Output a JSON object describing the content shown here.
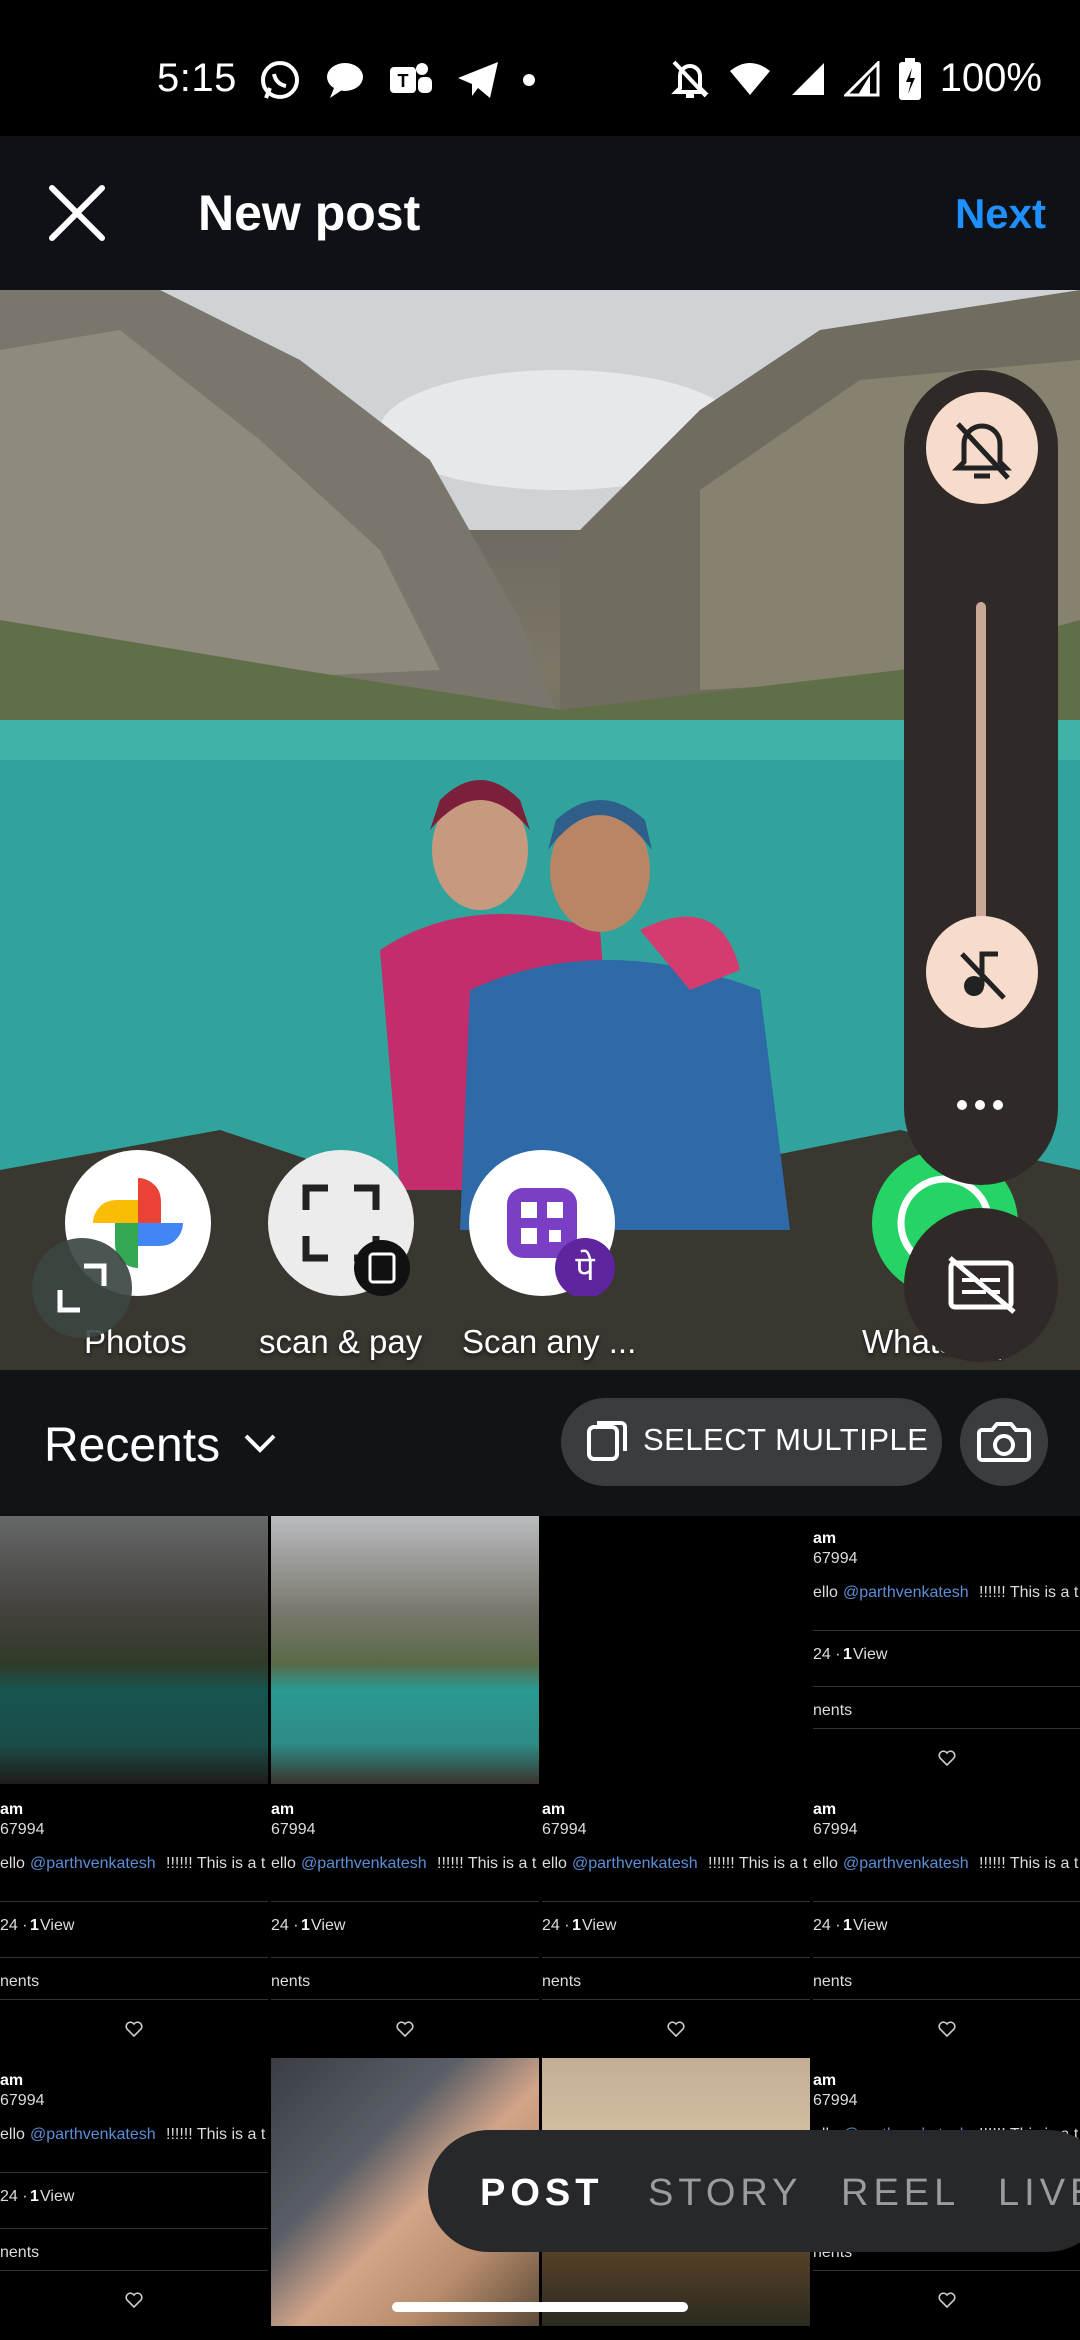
{
  "status_bar": {
    "time": "5:15",
    "battery": "100%",
    "left_icons": [
      "whatsapp-icon",
      "chat-icon",
      "teams-icon",
      "telegram-icon",
      "dot-icon"
    ],
    "right_icons": [
      "bell-off-icon",
      "wifi-icon",
      "signal-icon",
      "signal-icon-2",
      "battery-icon"
    ]
  },
  "header": {
    "title": "New post",
    "next_label": "Next"
  },
  "share_apps": [
    {
      "label": "Photos",
      "icon": "google-photos-icon"
    },
    {
      "label": "scan & pay",
      "icon": "scan-pay-icon"
    },
    {
      "label": "Scan any ...",
      "icon": "phonepe-scan-icon"
    },
    {
      "label": "WhatsApp",
      "icon": "whatsapp-icon"
    }
  ],
  "volume": {
    "level": 0,
    "top_icon": "bell-off-icon",
    "thumb_icon": "music-off-icon",
    "more_icon": "more-horizontal-icon",
    "caption_icon": "caption-off-icon"
  },
  "recents": {
    "label": "Recents",
    "select_multiple": "SELECT MULTIPLE"
  },
  "grid": {
    "tweet": {
      "name": "am",
      "handle": "67994",
      "body_prefix": "ello ",
      "mention": "@parthvenkatesh",
      "body_suffix": "!!!!!! This is a t",
      "meta_prefix": "24 · ",
      "views": "1",
      "views_label": " View",
      "comments": "nents"
    }
  },
  "modes": {
    "post": "POST",
    "story": "STORY",
    "reel": "REEL",
    "live": "LIVE"
  },
  "colors": {
    "accent": "#1e90ff",
    "volume_panel": "#2f2a27",
    "volume_button": "#f7dccc",
    "header_bg": "#0e1116"
  }
}
